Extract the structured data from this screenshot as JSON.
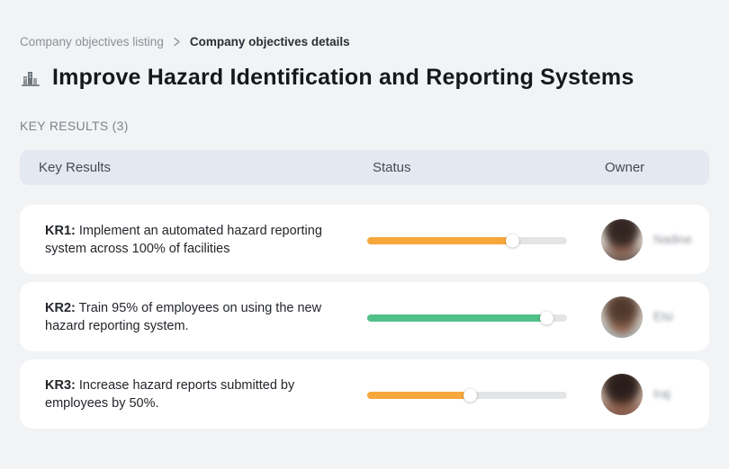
{
  "breadcrumb": {
    "items": [
      {
        "label": "Company objectives listing"
      },
      {
        "label": "Company objectives details"
      }
    ],
    "separator_icon": "chevron-right-icon"
  },
  "header": {
    "icon": "buildings-icon",
    "title": "Improve Hazard Identification and Reporting Systems"
  },
  "section": {
    "label": "KEY RESULTS (3)"
  },
  "table": {
    "columns": {
      "key_results": "Key Results",
      "status": "Status",
      "owner": "Owner"
    },
    "rows": [
      {
        "kr_label": "KR1:",
        "description": " Implement an automated hazard reporting system across 100% of facilities",
        "progress_percent": 73,
        "progress_color": "#F8A73C",
        "owner": "Nadine"
      },
      {
        "kr_label": "KR2:",
        "description": " Train 95% of employees on using the new hazard reporting system.",
        "progress_percent": 90,
        "progress_color": "#52C189",
        "owner": "Elsi"
      },
      {
        "kr_label": "KR3:",
        "description": " Increase hazard reports submitted by employees by 50%.",
        "progress_percent": 52,
        "progress_color": "#F8A73C",
        "owner": "Iraj"
      }
    ]
  },
  "colors": {
    "page_background": "#f2f3f5",
    "card_background": "#ffffff",
    "table_header_background": "#e4e8f0",
    "progress_track": "#e4e5e7",
    "progress_orange": "#F8A73C",
    "progress_green": "#52C189"
  }
}
